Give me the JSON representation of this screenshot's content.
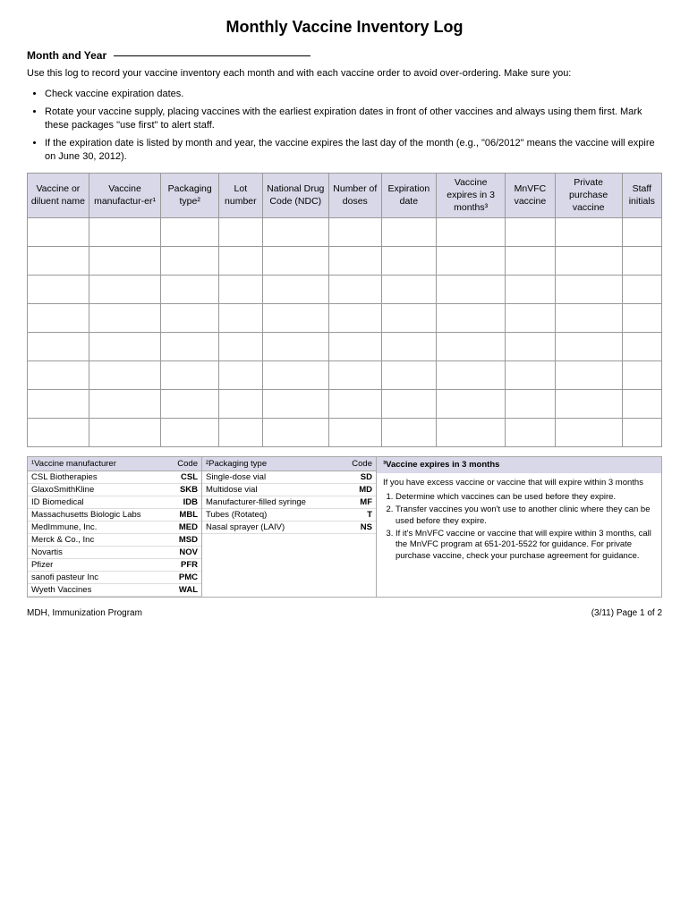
{
  "title": "Monthly Vaccine Inventory Log",
  "month_year_label": "Month and Year",
  "instructions": "Use this log to record your vaccine inventory each month and with each vaccine order to avoid over-ordering. Make sure you:",
  "bullets": [
    "Check vaccine expiration dates.",
    "Rotate your vaccine supply, placing vaccines with the earliest expiration dates in front of other vaccines and always using them first. Mark these packages \"use first\" to alert staff.",
    "If the expiration date is listed by month and year, the vaccine expires the last day of the month (e.g., \"06/2012\" means the vaccine will expire on June 30, 2012)."
  ],
  "table": {
    "headers": [
      "Vaccine or diluent name",
      "Vaccine manufactur-er¹",
      "Packaging type²",
      "Lot number",
      "National Drug Code (NDC)",
      "Number of doses",
      "Expiration date",
      "Vaccine expires in 3 months³",
      "MnVFC vaccine",
      "Private purchase vaccine",
      "Staff initials"
    ],
    "rows": 8
  },
  "footnote1": {
    "header": "¹Vaccine manufacturer",
    "code_header": "Code",
    "items": [
      {
        "name": "CSL Biotherapies",
        "code": "CSL"
      },
      {
        "name": "GlaxoSmithKline",
        "code": "SKB"
      },
      {
        "name": "ID Biomedical",
        "code": "IDB"
      },
      {
        "name": "Massachusetts Biologic Labs",
        "code": "MBL"
      },
      {
        "name": "MedImmune, Inc.",
        "code": "MED"
      },
      {
        "name": "Merck & Co., Inc",
        "code": "MSD"
      },
      {
        "name": "Novartis",
        "code": "NOV"
      },
      {
        "name": "Pfizer",
        "code": "PFR"
      },
      {
        "name": "sanofi pasteur Inc",
        "code": "PMC"
      },
      {
        "name": "Wyeth Vaccines",
        "code": "WAL"
      }
    ]
  },
  "footnote2": {
    "header": "²Packaging type",
    "code_header": "Code",
    "items": [
      {
        "name": "Single-dose vial",
        "code": "SD"
      },
      {
        "name": "Multidose vial",
        "code": "MD"
      },
      {
        "name": "Manufacturer-filled syringe",
        "code": "MF"
      },
      {
        "name": "Tubes (Rotateq)",
        "code": "T"
      },
      {
        "name": "Nasal sprayer (LAIV)",
        "code": "NS"
      }
    ]
  },
  "footnote3": {
    "header": "³Vaccine expires in 3 months",
    "intro": "If you have excess vaccine or vaccine that will expire within 3 months",
    "steps": [
      "Determine which vaccines can be used before they expire.",
      "Transfer vaccines you won't use to another clinic where they can be used before they expire.",
      "If it's MnVFC vaccine or vaccine that will expire within 3 months, call the MnVFC program at 651-201-5522 for guidance. For private purchase vaccine, check your purchase agreement for guidance."
    ]
  },
  "page_footer": {
    "left": "MDH, Immunization Program",
    "right": "(3/11) Page 1 of 2"
  }
}
